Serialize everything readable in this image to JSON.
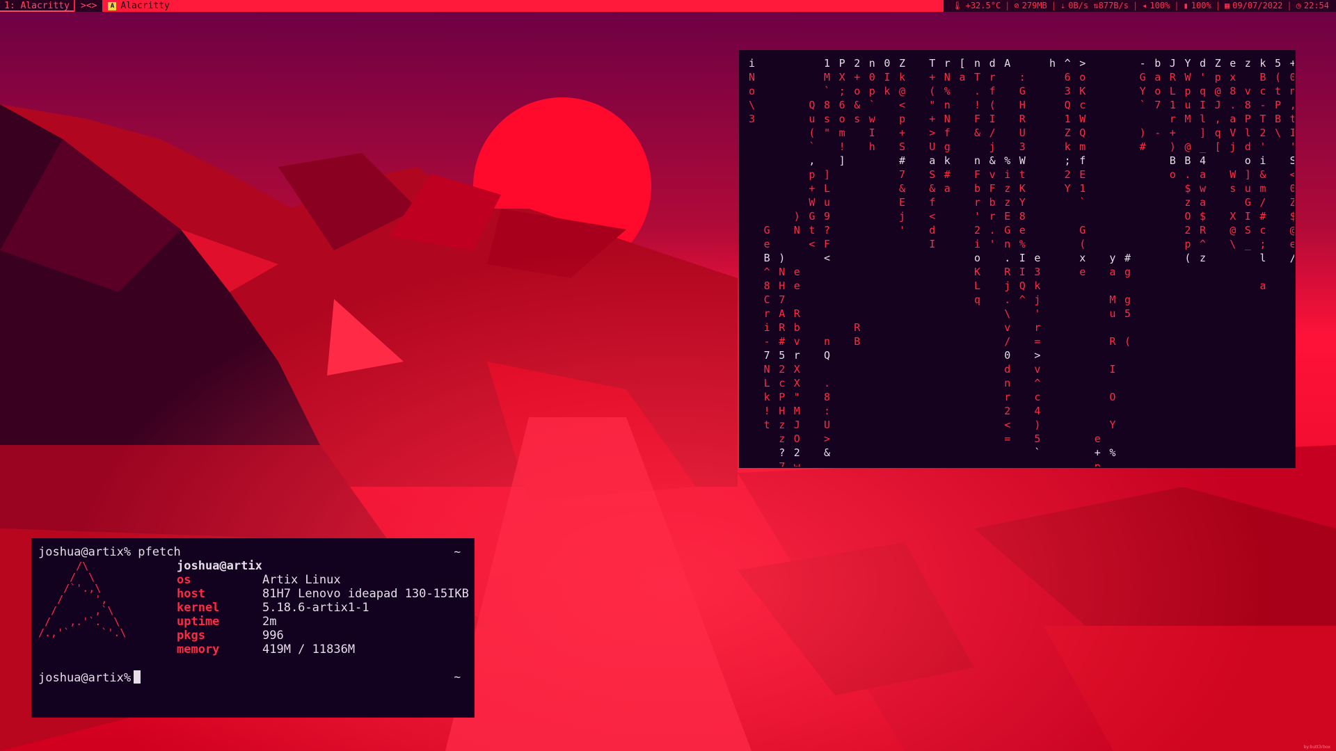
{
  "colors": {
    "accent": "#ff1a3c",
    "terminal_bg": "#12021f",
    "matrix_text": "#ff2a45",
    "bar_dark": "#2a0020"
  },
  "topbar": {
    "tag_label": "1: Alacritty",
    "layout_symbol": "><>",
    "app_icon": "A",
    "window_title": "Alacritty",
    "status": {
      "temp": "+32.5°C",
      "memory": "279MB",
      "network": "0B/s ⇅877B/s",
      "volume": "100%",
      "battery": "100%",
      "date": "09/07/2022",
      "time": "22:54"
    },
    "icons": [
      "thermometer-icon",
      "memory-icon",
      "network-icon",
      "volume-icon",
      "battery-icon",
      "calendar-icon",
      "clock-icon"
    ]
  },
  "pfetch": {
    "prompt_command": "joshua@artix% pfetch",
    "tilde": "~",
    "user_host": "joshua@artix",
    "art": "      /\\\n     /  \\\n    /`'.,\\\n   /     ',\n  /      ,`\\\n /   ,.'`.  \\\n/.,'`     `'.\\",
    "info": [
      {
        "label": "os",
        "value": "Artix Linux"
      },
      {
        "label": "host",
        "value": "81H7 Lenovo ideapad 130-15IKB"
      },
      {
        "label": "kernel",
        "value": "5.18.6-artix1-1"
      },
      {
        "label": "uptime",
        "value": "2m"
      },
      {
        "label": "pkgs",
        "value": "996"
      },
      {
        "label": "memory",
        "value": "419M / 11836M"
      }
    ],
    "prompt2": "joshua@artix%",
    "tilde2": "~"
  },
  "matrix": {
    "columns": [
      "iNo\\3                ",
      "            GeB^8Cri-7NLk!t",
      "              )NH7AR#52cPHzz?7KJMV",
      "           )N  ee RbvrXX\"MJO2w",
      "   Qu(`,p+WGt<                 ",
      "1M`8s\"  ]Lu9?F<     nQ .8:U>&",
      "PX;6om!]        ",
      "2+o&s              RB",
      "n0p`wIh           ",
      "0Ik            ",
      "Zk@<p+S#7&Ej'",
      "                                 J",
      "T+(\"+>UaS&f<dI",
      "rN%nNfgk#a",
      "[a              ",
      "nT.!F& nFbr'2ioKLq",
      "drf(I/j&vFbr.'",
      "A      %izzEGn.Rj.\\v/0dnr2<=",
      " :GHRU3WtKY8e%IIQ^",
      "              e3kj'r=>v^c4)5`",
      "h",
      "^63Q1Zk;2Y",
      ">oKcWQmfE1` G(xe",
      "                           e+p/h",
      "              ya Mu R I O Y % u j [",
      "              #g g5 (",
      "-GY` )#",
      "bao7 -",
      "JRL1r+)Bo",
      "YWpuM @B.$zO2p(",
      "d'qIl]_4awa$R^z",
      "Zp@J,q[    ",
      "ex8.aVj Ws X@\\",
      "z v8Pldo]uGIS_",
      "kBc-T2'i&m/#c;l a",
      "5(tPB\\",
      "+0n,tI'S<0Z$@e/",
      ")8h3hD",
      "#*@^EwyNn$ x-J:/Y?TynvX6r'Wm"
    ]
  },
  "watermark": "by:butt3rbox"
}
